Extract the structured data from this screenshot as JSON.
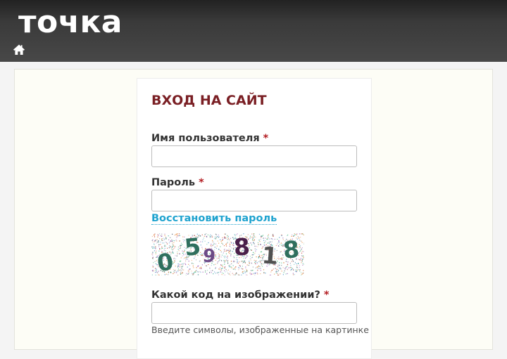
{
  "header": {
    "logo_text": "точка",
    "home_icon": "home-icon",
    "background": "#3a3a3a"
  },
  "login_form": {
    "title": "ВХОД НА САЙТ",
    "username": {
      "label": "Имя пользователя",
      "required_mark": "*",
      "value": ""
    },
    "password": {
      "label": "Пароль",
      "required_mark": "*",
      "value": ""
    },
    "restore_password_link": "Восстановить пароль",
    "captcha": {
      "digits": [
        "0",
        "5",
        "9",
        "8",
        "1",
        "8"
      ],
      "digit_colors": [
        "#2f6f5e",
        "#2f6f5e",
        "#6d4a86",
        "#4a1f4a",
        "#505050",
        "#2f6f5e"
      ]
    },
    "captcha_question": {
      "label": "Какой код на изображении?",
      "required_mark": "*",
      "value": "",
      "hint": "Введите символы, изображенные на картинке"
    }
  },
  "colors": {
    "title": "#7a1f24",
    "required": "#b31d22",
    "link": "#1fa3cf"
  }
}
